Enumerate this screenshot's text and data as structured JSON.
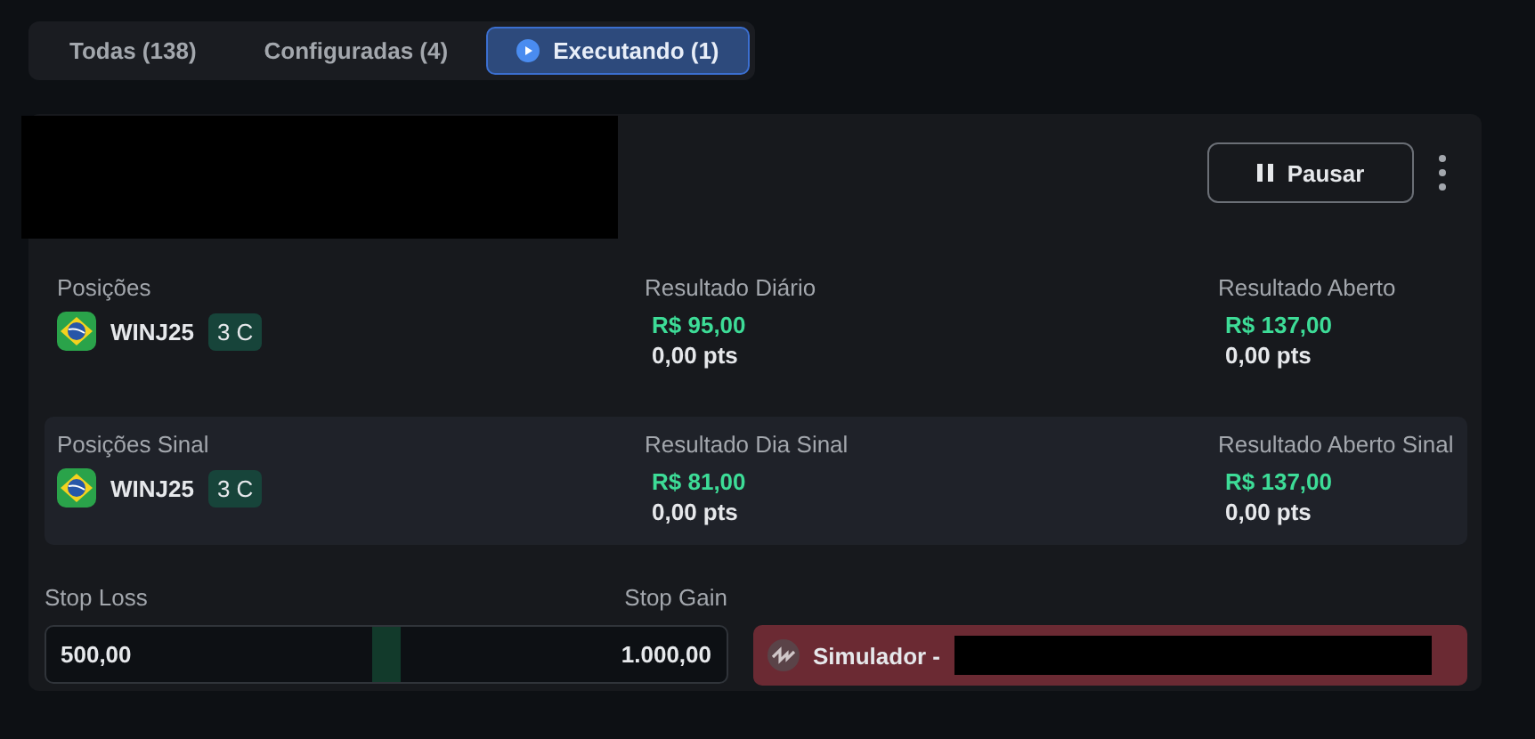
{
  "tabs": [
    {
      "label": "Todas (138)",
      "selected": false
    },
    {
      "label": "Configuradas (4)",
      "selected": false
    },
    {
      "label": "Executando (1)",
      "selected": true
    }
  ],
  "card": {
    "pause_button": "Pausar",
    "sections": [
      {
        "highlighted": false,
        "positions_label": "Posições",
        "symbol": "WINJ25",
        "contracts": "3 C",
        "results": [
          {
            "label": "Resultado Diário",
            "amount": "R$ 95,00",
            "points": "0,00 pts"
          },
          {
            "label": "Resultado Aberto",
            "amount": "R$ 137,00",
            "points": "0,00 pts"
          }
        ]
      },
      {
        "highlighted": true,
        "positions_label": "Posições Sinal",
        "symbol": "WINJ25",
        "contracts": "3 C",
        "results": [
          {
            "label": "Resultado Dia Sinal",
            "amount": "R$ 81,00",
            "points": "0,00 pts"
          },
          {
            "label": "Resultado Aberto Sinal",
            "amount": "R$ 137,00",
            "points": "0,00 pts"
          }
        ]
      }
    ],
    "stop_loss": {
      "label": "Stop Loss",
      "value": "500,00"
    },
    "stop_gain": {
      "label": "Stop Gain",
      "value": "1.000,00"
    },
    "account": "Simulador -"
  }
}
